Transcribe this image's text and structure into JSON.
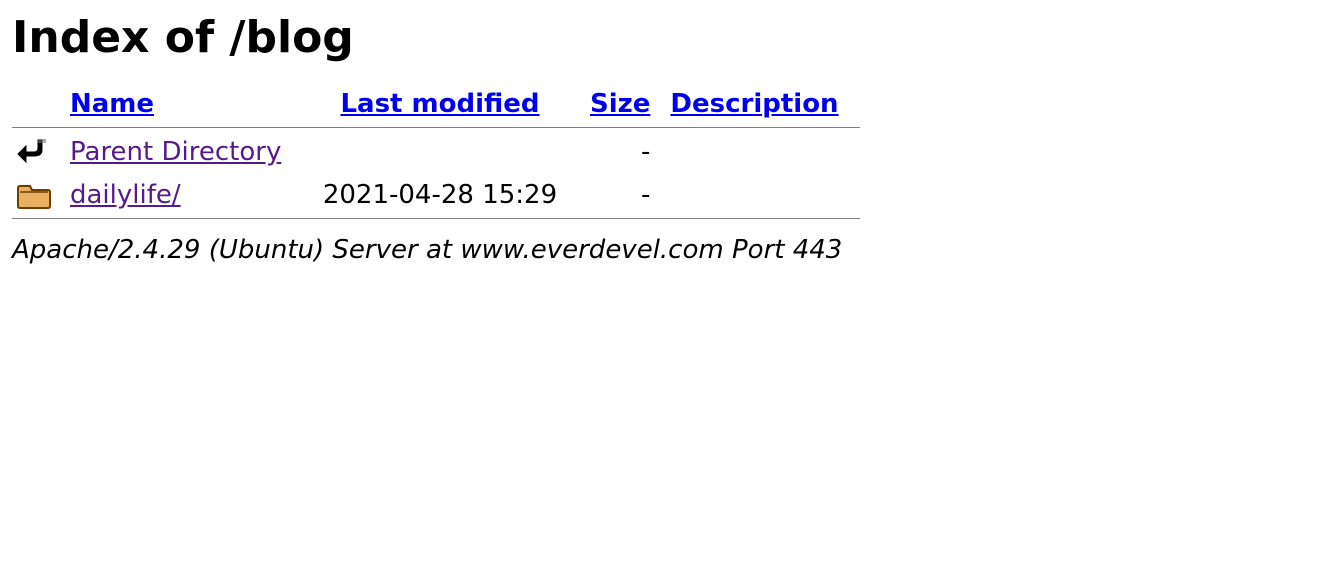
{
  "title": "Index of /blog",
  "columns": {
    "name": "Name",
    "last_modified": "Last modified",
    "size": "Size",
    "description": "Description"
  },
  "rows": [
    {
      "icon": "back-icon",
      "name": "Parent Directory",
      "link_class": "visited",
      "last_modified": "",
      "size": "-",
      "description": ""
    },
    {
      "icon": "folder-icon",
      "name": "dailylife/",
      "link_class": "visited",
      "last_modified": "2021-04-28 15:29",
      "size": "-",
      "description": ""
    }
  ],
  "footer": "Apache/2.4.29 (Ubuntu) Server at www.everdevel.com Port 443"
}
